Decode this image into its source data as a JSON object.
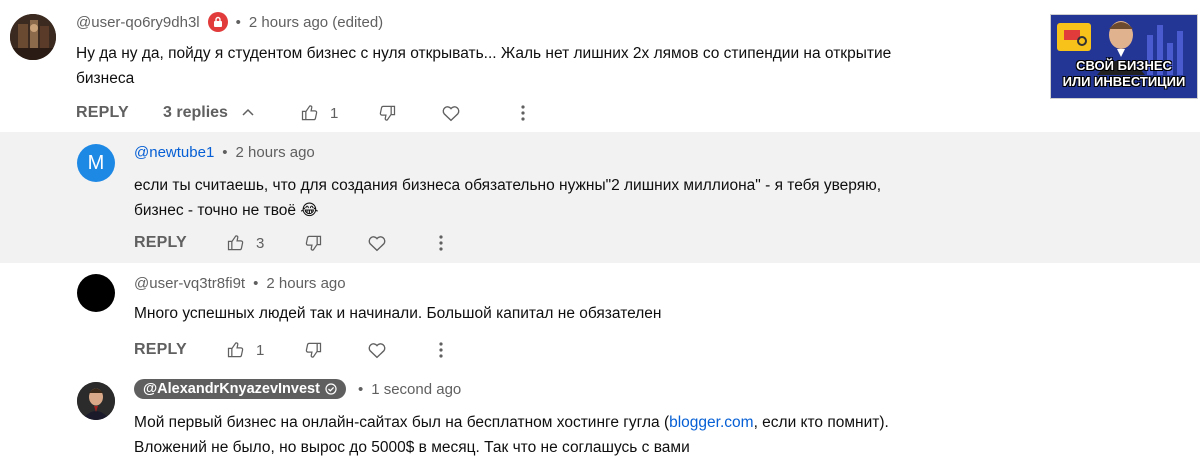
{
  "top_comment": {
    "author": "@user-qo6ry9dh3l",
    "time": "2 hours ago (edited)",
    "text_line1": "Ну да ну да, пойду я студентом бизнес с нуля открывать... Жаль нет лишних 2х лямов со стипендии на открытие",
    "text_line2": "бизнеса",
    "reply_label": "REPLY",
    "replies_label": "3 replies",
    "like_count": "1"
  },
  "thumbnail": {
    "title_line1": "СВОЙ БИЗНЕС",
    "title_line2": "ИЛИ ИНВЕСТИЦИИ"
  },
  "replies": [
    {
      "avatar_letter": "M",
      "author": "@newtube1",
      "time": "2 hours ago",
      "text_line1": "если ты считаешь, что для создания бизнеса обязательно нужны\"2 лишних миллиона\" - я тебя уверяю,",
      "text_line2": "бизнес - точно не твоё 😂",
      "reply_label": "REPLY",
      "like_count": "3"
    },
    {
      "author": "@user-vq3tr8fi9t",
      "time": "2 hours ago",
      "text_line1": "Много успешных людей так и начинали. Большой капитал не обязателен",
      "reply_label": "REPLY",
      "like_count": "1"
    },
    {
      "author": "@AlexandrKnyazevInvest",
      "time": "1 second ago",
      "text_line1_before": "Мой первый бизнес на онлайн-сайтах был на бесплатном хостинге гугла (",
      "text_link": "blogger.com",
      "text_line1_after": ", если кто помнит).",
      "text_line2": "Вложений не было, но вырос до 5000$ в месяц. Так что не соглашусь с вами"
    }
  ],
  "separator": "•",
  "icons": [
    "lock-icon",
    "chevron-up-icon",
    "thumb-up-icon",
    "thumb-down-icon",
    "heart-icon",
    "more-vert-icon",
    "verified-check-icon"
  ],
  "colors": {
    "highlight_bg": "#f2f2f2",
    "link": "#065fd4",
    "muted": "#606060",
    "lock_badge": "#e23b3b",
    "owner_badge": "#5f5f5f"
  }
}
